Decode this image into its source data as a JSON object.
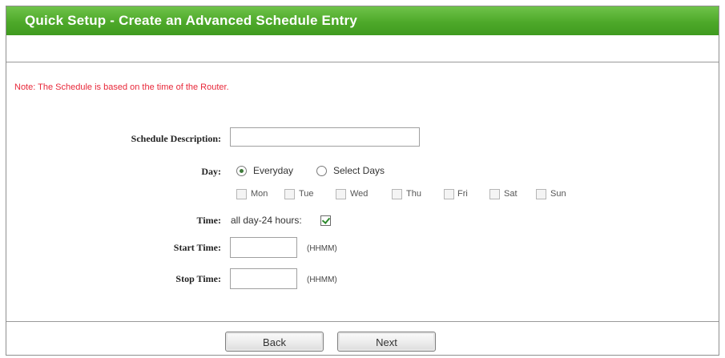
{
  "header": {
    "title": "Quick Setup - Create an Advanced Schedule Entry"
  },
  "note": "Note: The Schedule is based on the time of the Router.",
  "form": {
    "description_label": "Schedule Description:",
    "description_value": "",
    "day_label": "Day:",
    "day_options": [
      "Everyday",
      "Select Days"
    ],
    "day_selected": "Everyday",
    "days": [
      "Mon",
      "Tue",
      "Wed",
      "Thu",
      "Fri",
      "Sat",
      "Sun"
    ],
    "time_label": "Time:",
    "all_day_text": "all day-24 hours:",
    "all_day_checked": true,
    "start_label": "Start Time:",
    "start_value": "",
    "start_hint": "(HHMM)",
    "stop_label": "Stop Time:",
    "stop_value": "",
    "stop_hint": "(HHMM)"
  },
  "buttons": {
    "back": "Back",
    "next": "Next"
  }
}
